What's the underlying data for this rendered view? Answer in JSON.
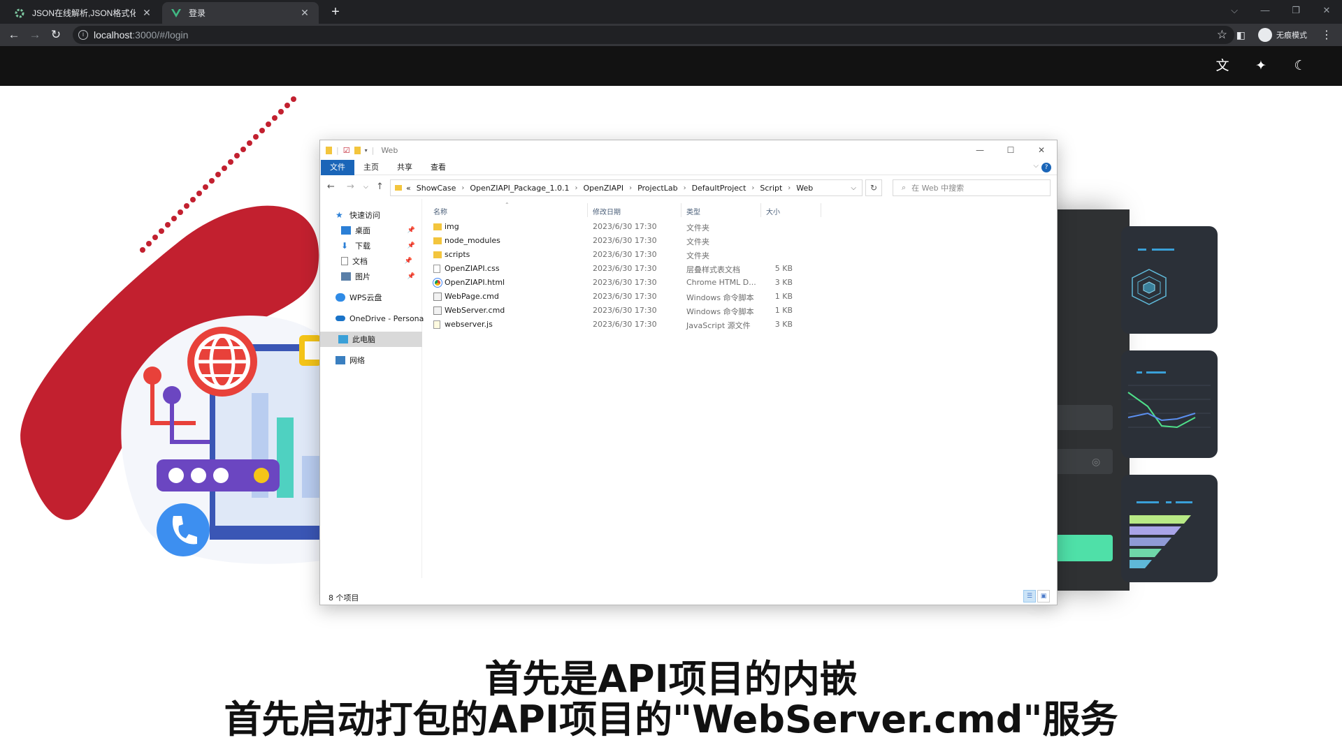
{
  "browser": {
    "tabs": [
      {
        "title": "JSON在线解析,JSON格式化,JSO",
        "active": false
      },
      {
        "title": "登录",
        "active": true
      }
    ],
    "new_tab": "+",
    "url_host": "localhost",
    "url_path": ":3000/#/login",
    "profile_label": "无痕模式"
  },
  "appbar": {
    "icons": [
      "translate-icon",
      "magic-wand-icon",
      "moon-icon"
    ]
  },
  "explorer": {
    "window_title": "Web",
    "ribbon_tabs": [
      "文件",
      "主页",
      "共享",
      "查看"
    ],
    "breadcrumb": [
      "«",
      "ShowCase",
      "OpenZIAPI_Package_1.0.1",
      "OpenZIAPI",
      "ProjectLab",
      "DefaultProject",
      "Script",
      "Web"
    ],
    "search_placeholder": "在 Web 中搜索",
    "nav": [
      {
        "label": "快速访问",
        "icon": "star-icon",
        "color": "#2b7fd6",
        "pinned": false
      },
      {
        "label": "桌面",
        "icon": "desktop-icon",
        "color": "#2b7fd6",
        "pinned": true
      },
      {
        "label": "下载",
        "icon": "download-icon",
        "color": "#2b7fd6",
        "pinned": true
      },
      {
        "label": "文档",
        "icon": "document-icon",
        "color": "#8a8a8a",
        "pinned": true
      },
      {
        "label": "图片",
        "icon": "pictures-icon",
        "color": "#5a7fa8",
        "pinned": true
      },
      {
        "label": "WPS云盘",
        "icon": "cloud-icon",
        "color": "#2f8be6",
        "pinned": false
      },
      {
        "label": "OneDrive - Persona",
        "icon": "onedrive-icon",
        "color": "#1a73c8",
        "pinned": false
      },
      {
        "label": "此电脑",
        "icon": "computer-icon",
        "color": "#3aa0d8",
        "pinned": false
      },
      {
        "label": "网络",
        "icon": "network-icon",
        "color": "#3a7fc0",
        "pinned": false
      }
    ],
    "columns": [
      "名称",
      "修改日期",
      "类型",
      "大小"
    ],
    "files": [
      {
        "name": "img",
        "date": "2023/6/30 17:30",
        "type": "文件夹",
        "size": "",
        "icon": "folder-icon"
      },
      {
        "name": "node_modules",
        "date": "2023/6/30 17:30",
        "type": "文件夹",
        "size": "",
        "icon": "folder-icon"
      },
      {
        "name": "scripts",
        "date": "2023/6/30 17:30",
        "type": "文件夹",
        "size": "",
        "icon": "folder-icon"
      },
      {
        "name": "OpenZIAPI.css",
        "date": "2023/6/30 17:30",
        "type": "层叠样式表文档",
        "size": "5 KB",
        "icon": "css-file-icon"
      },
      {
        "name": "OpenZIAPI.html",
        "date": "2023/6/30 17:30",
        "type": "Chrome HTML D...",
        "size": "3 KB",
        "icon": "chrome-icon"
      },
      {
        "name": "WebPage.cmd",
        "date": "2023/6/30 17:30",
        "type": "Windows 命令脚本",
        "size": "1 KB",
        "icon": "cmd-file-icon"
      },
      {
        "name": "WebServer.cmd",
        "date": "2023/6/30 17:30",
        "type": "Windows 命令脚本",
        "size": "1 KB",
        "icon": "cmd-file-icon"
      },
      {
        "name": "webserver.js",
        "date": "2023/6/30 17:30",
        "type": "JavaScript 源文件",
        "size": "3 KB",
        "icon": "js-file-icon"
      }
    ],
    "status": "8 个项目"
  },
  "subtitles": {
    "line1": "首先是API项目的内嵌",
    "line2": "首先启动打包的API项目的\"WebServer.cmd\"服务"
  },
  "colors": {
    "accent_green": "#4fe0a8",
    "illustration_red": "#c2202f",
    "ribbon_blue": "#1a65b8"
  }
}
